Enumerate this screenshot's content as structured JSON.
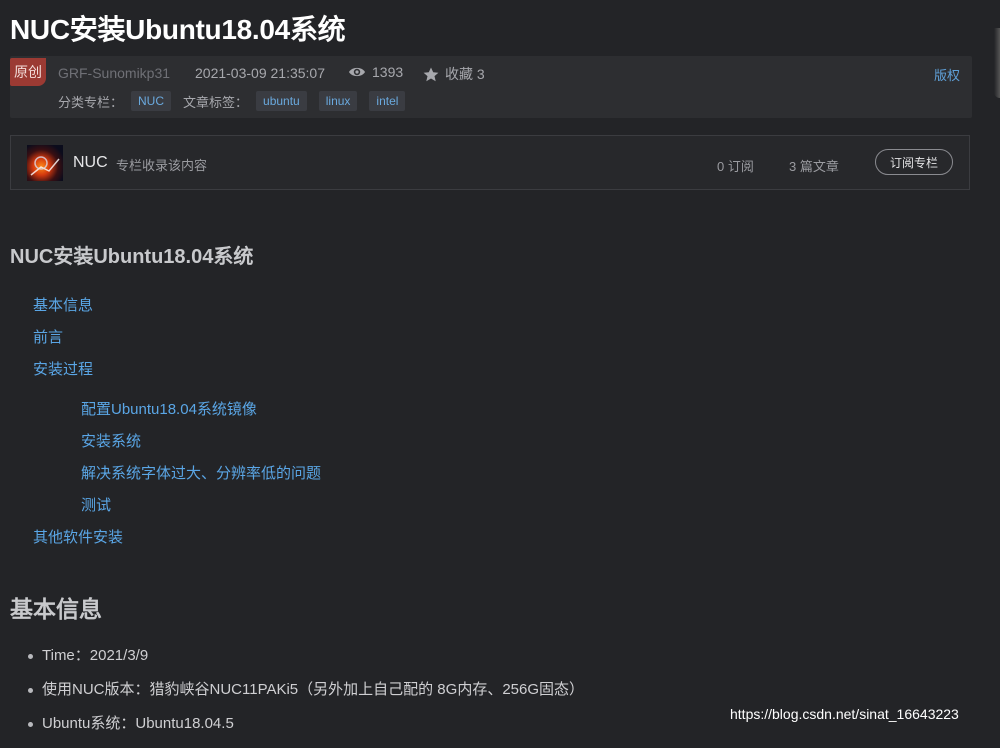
{
  "article": {
    "title": "NUC安装Ubuntu18.04系统",
    "badge": "原创",
    "author": "GRF-Sunomikp31",
    "date": "2021-03-09 21:35:07",
    "views": "1393",
    "favorites": "收藏 3",
    "copyright": "版权",
    "category_label": "分类专栏：",
    "categories": [
      "NUC"
    ],
    "tags_label": "文章标签：",
    "tags": [
      "ubuntu",
      "linux",
      "intel"
    ]
  },
  "column": {
    "name": "NUC",
    "desc": "专栏收录该内容",
    "subscribers": "0 订阅",
    "articles": "3 篇文章",
    "subscribe_label": "订阅专栏"
  },
  "toc": {
    "heading": "NUC安装Ubuntu18.04系统",
    "items": [
      {
        "label": "基本信息",
        "level": 1
      },
      {
        "label": "前言",
        "level": 1
      },
      {
        "label": "安装过程",
        "level": 1
      },
      {
        "label": "配置Ubuntu18.04系统镜像",
        "level": 2
      },
      {
        "label": "安装系统",
        "level": 2
      },
      {
        "label": "解决系统字体过大、分辨率低的问题",
        "level": 2
      },
      {
        "label": "测试",
        "level": 2
      },
      {
        "label": "其他软件安装",
        "level": 1
      }
    ]
  },
  "section": {
    "heading": "基本信息",
    "items": [
      "Time：2021/3/9",
      "使用NUC版本：猎豹峡谷NUC11PAKi5（另外加上自己配的 8G内存、256G固态）",
      "Ubuntu系统：Ubuntu18.04.5"
    ]
  },
  "watermark": "https://blog.csdn.net/sinat_16643223",
  "icons": {
    "views": "eye-icon",
    "favorites": "star-icon"
  }
}
